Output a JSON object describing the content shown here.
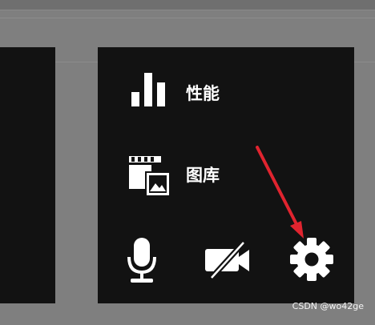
{
  "menu": {
    "items": [
      {
        "label": "性能",
        "icon": "bar-chart-icon"
      },
      {
        "label": "图库",
        "icon": "gallery-icon"
      }
    ]
  },
  "controls": [
    {
      "icon": "microphone-icon"
    },
    {
      "icon": "camera-off-icon"
    },
    {
      "icon": "gear-icon"
    }
  ],
  "annotation": {
    "icon": "red-arrow-icon",
    "color": "#e0242f"
  },
  "watermark": {
    "text": "CSDN @wo42ge"
  },
  "colors": {
    "panel": "#121212",
    "background": "#7f7f7f",
    "icon": "#ffffff"
  }
}
